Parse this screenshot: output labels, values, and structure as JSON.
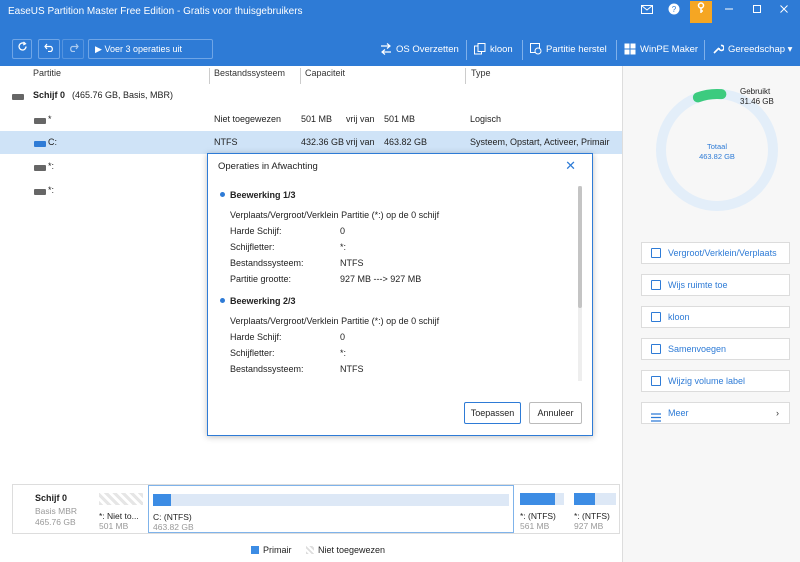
{
  "window": {
    "title": "EaseUS Partition Master Free Edition - Gratis voor thuisgebruikers"
  },
  "toolbar": {
    "apply_label": "Voer 3 operaties uit",
    "items": [
      "OS Overzetten",
      "kloon",
      "Partitie herstel",
      "WinPE Maker",
      "Gereedschap"
    ]
  },
  "table": {
    "headers": [
      "Partitie",
      "Bestandssysteem",
      "Capaciteit",
      "Type"
    ],
    "disk": "Schijf 0",
    "disk_info": "(465.76 GB, Basis, MBR)",
    "rows": [
      {
        "name": "*",
        "fs": "Niet toegewezen",
        "cap": "501 MB",
        "free_label": "vrij van",
        "total": "501 MB",
        "type": "Logisch"
      },
      {
        "name": "C:",
        "fs": "NTFS",
        "cap": "432.36 GB",
        "free_label": "vrij van",
        "total": "463.82 GB",
        "type": "Systeem, Opstart, Activeer, Primair"
      },
      {
        "name": "*:",
        "fs": "",
        "cap": "",
        "free_label": "",
        "total": "",
        "type": ""
      },
      {
        "name": "*:",
        "fs": "",
        "cap": "",
        "free_label": "",
        "total": "",
        "type": ""
      }
    ]
  },
  "usage": {
    "used_label": "Gebruikt",
    "used_value": "31.46 GB",
    "total_label": "Totaal",
    "total_value": "463.82 GB",
    "used_fraction": 0.068,
    "accent": "#3ccb7f",
    "ring": "#e3eef9"
  },
  "actions": [
    "Vergroot/Verklein/Verplaats",
    "Wijs ruimte toe",
    "kloon",
    "Samenvoegen",
    "Wijzig volume label",
    "Meer"
  ],
  "dialog": {
    "title": "Operaties in Afwachting",
    "op1": {
      "heading": "Beewerking 1/3",
      "desc": "Verplaats/Vergroot/Verklein Partitie (*:) op de 0 schijf",
      "l1": "Harde Schijf:",
      "v1": "0",
      "l2": "Schijfletter:",
      "v2": "*:",
      "l3": "Bestandssysteem:",
      "v3": "NTFS",
      "l4": "Partitie grootte:",
      "v4": "927 MB ---> 927 MB"
    },
    "op2": {
      "heading": "Beewerking 2/3",
      "desc": "Verplaats/Vergroot/Verklein Partitie (*:) op de 0 schijf",
      "l1": "Harde Schijf:",
      "v1": "0",
      "l2": "Schijfletter:",
      "v2": "*:",
      "l3": "Bestandssysteem:",
      "v3": "NTFS"
    },
    "apply": "Toepassen",
    "cancel": "Annuleer"
  },
  "diskmap": {
    "disk": "Schijf 0",
    "type": "Basis MBR",
    "size": "465.76 GB",
    "p1": {
      "label": "*: Niet to...",
      "size": "501 MB"
    },
    "p2": {
      "label": "C:  (NTFS)",
      "size": "463.82 GB",
      "fill": 0.05
    },
    "p3": {
      "label": "*:  (NTFS)",
      "size": "561 MB",
      "fill": 0.8
    },
    "p4": {
      "label": "*:  (NTFS)",
      "size": "927 MB",
      "fill": 0.5
    }
  },
  "legend": {
    "primary": "Primair",
    "unallocated": "Niet toegewezen"
  },
  "colors": {
    "accent": "#2e7bd6",
    "help": "#f5a623"
  }
}
